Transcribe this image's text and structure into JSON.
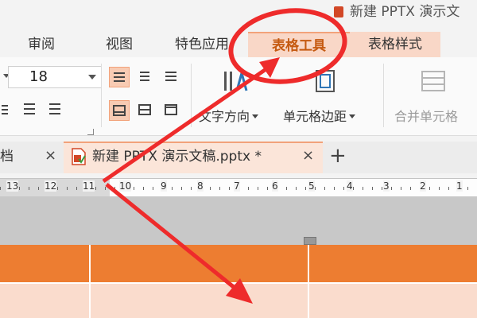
{
  "window": {
    "document_title": "新建 PPTX 演示文"
  },
  "ribbon_tabs": [
    {
      "label": "审阅"
    },
    {
      "label": "视图"
    },
    {
      "label": "特色应用"
    },
    {
      "label": "表格工具"
    },
    {
      "label": "表格样式"
    }
  ],
  "ribbon": {
    "font_size": "18",
    "text_direction_label": "文字方向",
    "cell_margin_label": "单元格边距",
    "merge_cells_label": "合并单元格"
  },
  "doc_tabs": {
    "prev_tab_fragment": "档",
    "active_tab_label": "新建 PPTX 演示文稿.pptx *",
    "new_tab_symbol": "+"
  },
  "ruler": {
    "labels": [
      "13",
      "12",
      "11",
      "10",
      "9",
      "8",
      "7",
      "6",
      "5",
      "4",
      "3",
      "2",
      "1"
    ]
  },
  "colors": {
    "accent": "#c55a11",
    "table_header": "#ed7d31",
    "table_body": "#fadccd",
    "annotation": "#ee2b2b"
  }
}
